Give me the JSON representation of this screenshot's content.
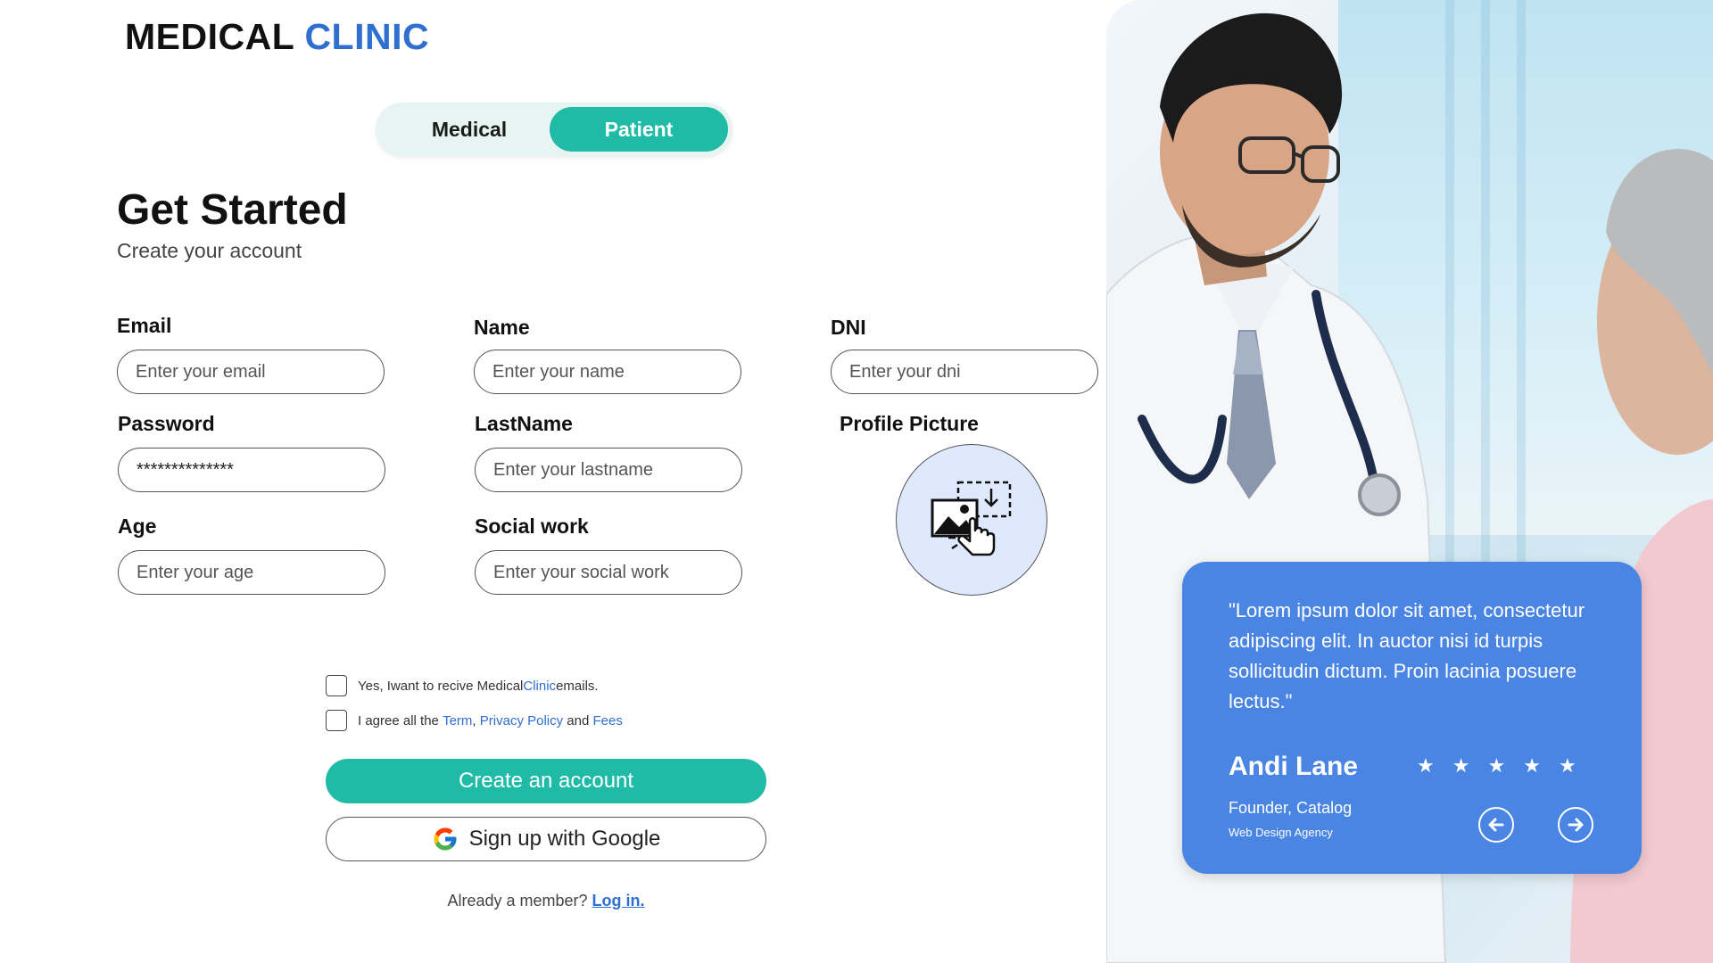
{
  "brand": {
    "part1": "MEDICAL",
    "part2": "CLINIC",
    "colors": {
      "dark": "#111111",
      "blue": "#2f6fcf"
    }
  },
  "role_switch": {
    "options": [
      "Medical",
      "Patient"
    ],
    "selected": "Patient",
    "accent": "#20bba7"
  },
  "header": {
    "title": "Get Started",
    "subtitle": "Create your account"
  },
  "form": {
    "email": {
      "label": "Email",
      "placeholder": "Enter your email"
    },
    "name": {
      "label": "Name",
      "placeholder": "Enter your name"
    },
    "dni": {
      "label": "DNI",
      "placeholder": "Enter your dni"
    },
    "password": {
      "label": "Password",
      "value": "**************"
    },
    "lastname": {
      "label": "LastName",
      "placeholder": "Enter your lastname"
    },
    "profile_picture": {
      "label": "Profile Picture",
      "icon": "image-upload-icon"
    },
    "age": {
      "label": "Age",
      "placeholder": "Enter your age"
    },
    "social_work": {
      "label": "Social work",
      "placeholder": "Enter your social work"
    }
  },
  "consents": {
    "emails": {
      "prefix": "Yes, Iwant to recive Medical",
      "brand": "Clinic",
      "suffix": " emails."
    },
    "terms": {
      "prefix": "I agree all the ",
      "term": "Term",
      "sep": ", ",
      "privacy": "Privacy Policy",
      "and": " and ",
      "fees": "Fees"
    }
  },
  "actions": {
    "create": "Create an account",
    "google": "Sign up with Google",
    "member_text": "Already a member? ",
    "login": "Log in."
  },
  "testimonial": {
    "quote": "\"Lorem ipsum dolor sit amet, consectetur adipiscing elit. In auctor nisi id turpis sollicitudin dictum. Proin lacinia posuere lectus.\"",
    "name": "Andi Lane",
    "role": "Founder, Catalog",
    "company": "Web Design Agency",
    "rating": 5,
    "card_color": "#4a85e3"
  }
}
